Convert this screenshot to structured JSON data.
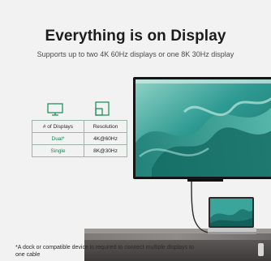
{
  "header": {
    "title": "Everything is on Display",
    "subtitle": "Supports up to two 4K 60Hz displays or one 8K 30Hz display"
  },
  "icons": {
    "displays": "monitor-icon",
    "resolution": "resolution-icon"
  },
  "spec_table": {
    "headers": [
      "# of Displays",
      "Resolution"
    ],
    "rows": [
      [
        "Dual*",
        "4K@60Hz"
      ],
      [
        "Single",
        "8K@30Hz"
      ]
    ]
  },
  "footnote": "*A dock or compatible device is required to connect multiple displays to one cable",
  "colors": {
    "accent_green": "#0f8a52",
    "background": "#f1f2f1",
    "screen_teal": "#2e9a92"
  }
}
